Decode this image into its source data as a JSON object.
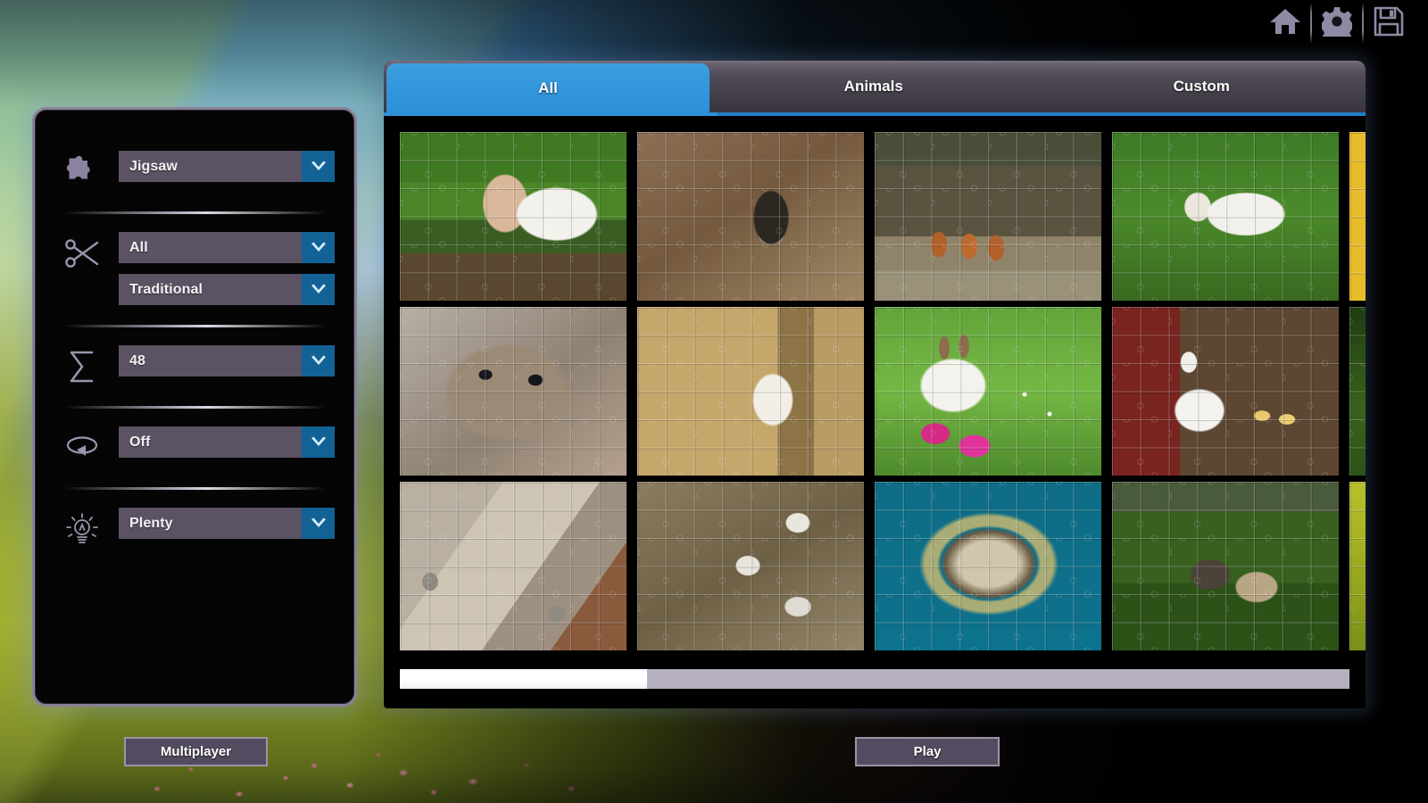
{
  "toolbar": {
    "buttons": [
      {
        "name": "home",
        "icon": "home-icon"
      },
      {
        "name": "settings",
        "icon": "gear-icon"
      },
      {
        "name": "save",
        "icon": "save-icon"
      }
    ]
  },
  "settings": {
    "groups": [
      {
        "icon": "puzzle-piece-icon",
        "fields": [
          {
            "name": "puzzle-type",
            "value": "Jigsaw"
          }
        ]
      },
      {
        "icon": "scissors-icon",
        "fields": [
          {
            "name": "cut-shape",
            "value": "All"
          },
          {
            "name": "cut-style",
            "value": "Traditional"
          }
        ]
      },
      {
        "icon": "sigma-icon",
        "fields": [
          {
            "name": "piece-count",
            "value": "48"
          }
        ]
      },
      {
        "icon": "rotation-icon",
        "fields": [
          {
            "name": "rotation",
            "value": "Off"
          }
        ]
      },
      {
        "icon": "brightness-icon",
        "fields": [
          {
            "name": "hints",
            "value": "Plenty"
          }
        ]
      }
    ]
  },
  "gallery": {
    "tabs": [
      {
        "label": "All",
        "active": true
      },
      {
        "label": "Animals",
        "active": false
      },
      {
        "label": "Custom",
        "active": false
      }
    ],
    "thumbnails": [
      {
        "alt": "two goat kids nuzzling in grass",
        "art": "art-goats"
      },
      {
        "alt": "raccoon peeking from tree hollow",
        "art": "art-raccoon"
      },
      {
        "alt": "red fox kits outside den",
        "art": "art-foxes"
      },
      {
        "alt": "white lamb lying in green grass",
        "art": "art-lamb"
      },
      {
        "alt": "black cat on yellow sunflower",
        "art": "art-sunflower"
      },
      {
        "alt": "close-up of a hamster",
        "art": "art-hamster"
      },
      {
        "alt": "white goat kid in a barn doorway",
        "art": "art-kid"
      },
      {
        "alt": "rabbit with pink easter eggs and daisies",
        "art": "art-bunny"
      },
      {
        "alt": "white muscovy duck with ducklings",
        "art": "art-duck"
      },
      {
        "alt": "tall green grass",
        "art": "art-grass"
      },
      {
        "alt": "ground squirrels among stone slabs",
        "art": "art-squirrels"
      },
      {
        "alt": "kittens sleeping on a mat",
        "art": "art-kittens"
      },
      {
        "alt": "ferrets curled in a woven basket",
        "art": "art-ferrets"
      },
      {
        "alt": "ducklings huddled in grass",
        "art": "art-ducklings"
      },
      {
        "alt": "sunlit yellow green grass",
        "art": "art-grass2"
      }
    ],
    "scrollbar": {
      "thumb_percent": 26
    }
  },
  "actions": {
    "multiplayer_label": "Multiplayer",
    "play_label": "Play"
  },
  "colors": {
    "accent_blue": "#3598dd",
    "dropdown_arrow_blue": "#136296",
    "dropdown_bg": "#5b5263",
    "panel_border": "#8a8198",
    "button_bg": "#534c60",
    "icon_purple": "#8d8aa3",
    "scroll_thumb": "#ffffff",
    "scroll_track": "#b6afc0"
  }
}
